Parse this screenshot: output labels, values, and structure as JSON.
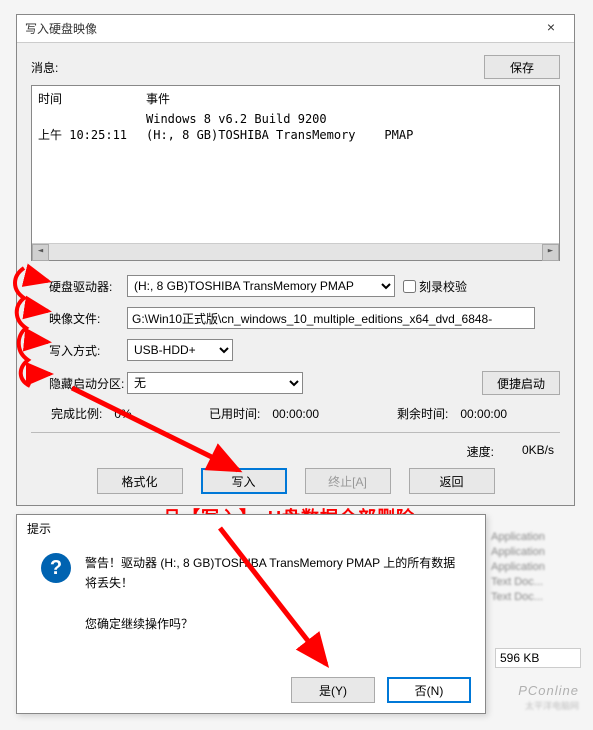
{
  "window": {
    "title": "写入硬盘映像",
    "msg_label": "消息:",
    "save_btn": "保存",
    "log": {
      "col_time": "时间",
      "col_event": "事件",
      "lines": [
        {
          "time": "",
          "event": "Windows 8 v6.2 Build 9200"
        },
        {
          "time": "上午 10:25:11",
          "event": "(H:, 8 GB)TOSHIBA TransMemory    PMAP"
        }
      ]
    },
    "form": {
      "drive_label": "硬盘驱动器:",
      "drive_value": "(H:, 8 GB)TOSHIBA TransMemory    PMAP",
      "verify_label": "刻录校验",
      "image_label": "映像文件:",
      "image_value": "G:\\Win10正式版\\cn_windows_10_multiple_editions_x64_dvd_6848-",
      "write_mode_label": "写入方式:",
      "write_mode_value": "USB-HDD+",
      "hide_boot_label": "隐藏启动分区:",
      "hide_boot_value": "无",
      "quick_boot_btn": "便捷启动"
    },
    "stats": {
      "progress_label": "完成比例:",
      "progress_value": "0%",
      "elapsed_label": "已用时间:",
      "elapsed_value": "00:00:00",
      "remain_label": "剩余时间:",
      "remain_value": "00:00:00",
      "speed_label": "速度:",
      "speed_value": "0KB/s"
    },
    "actions": {
      "format": "格式化",
      "write": "写入",
      "stop": "终止[A]",
      "back": "返回"
    }
  },
  "dialog": {
    "title": "提示",
    "warning1": "警告！驱动器 (H:, 8 GB)TOSHIBA TransMemory    PMAP 上的所有数据将丢失！",
    "confirm": "您确定继续操作吗？",
    "yes": "是(Y)",
    "no": "否(N)"
  },
  "annotation": "一旦【写入】，U盘数据全部删除",
  "background": {
    "blur_lines": [
      "Application",
      "Application",
      "Application",
      "Text Doc...",
      "Text Doc..."
    ],
    "size": "596 KB"
  },
  "watermark": {
    "main": "PConline",
    "sub": "太平洋电脑网"
  }
}
